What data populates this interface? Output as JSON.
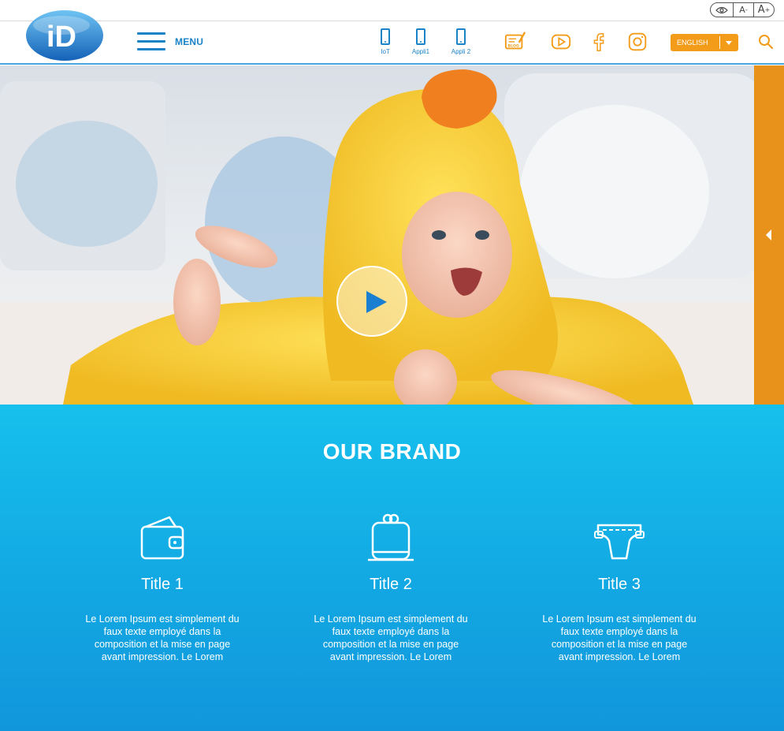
{
  "accessibility": {
    "contrast_icon": "eye-icon",
    "font_decrease_label": "A",
    "font_decrease_sup": "-",
    "font_increase_label": "A",
    "font_increase_sup": "+"
  },
  "header": {
    "logo_text": "iD",
    "menu_label": "MENU",
    "devices": [
      {
        "label": "IoT",
        "icon": "phone-icon"
      },
      {
        "label": "Appli1",
        "icon": "phone-icon"
      },
      {
        "label": "Appli 2",
        "icon": "phone-icon"
      }
    ],
    "blog_label": "BLOG",
    "social": [
      "blog-icon",
      "youtube-icon",
      "facebook-icon",
      "instagram-icon"
    ],
    "language": "ENGLISH",
    "search_icon": "search-icon"
  },
  "hero": {
    "image": "baby-in-yellow-duck-towel",
    "play_icon": "play-icon",
    "side_tab_icon": "chevron-left-icon"
  },
  "brand": {
    "title": "OUR BRAND",
    "features": [
      {
        "icon": "wallet-icon",
        "title": "Title 1",
        "text": "Le Lorem Ipsum est simplement du faux texte employé dans la composition et la mise en page avant impression. Le Lorem"
      },
      {
        "icon": "bag-icon",
        "title": "Title 2",
        "text": "Le Lorem Ipsum est simplement du faux texte employé dans la composition et la mise en page avant impression. Le Lorem"
      },
      {
        "icon": "diaper-icon",
        "title": "Title 3",
        "text": "Le Lorem Ipsum est simplement du faux texte employé dans la composition et la mise en page avant impression. Le Lorem"
      }
    ]
  },
  "colors": {
    "primary_blue": "#1a82c6",
    "accent_orange": "#f39c1a",
    "brand_bg_top": "#16c0ec",
    "brand_bg_bottom": "#1196dc"
  }
}
